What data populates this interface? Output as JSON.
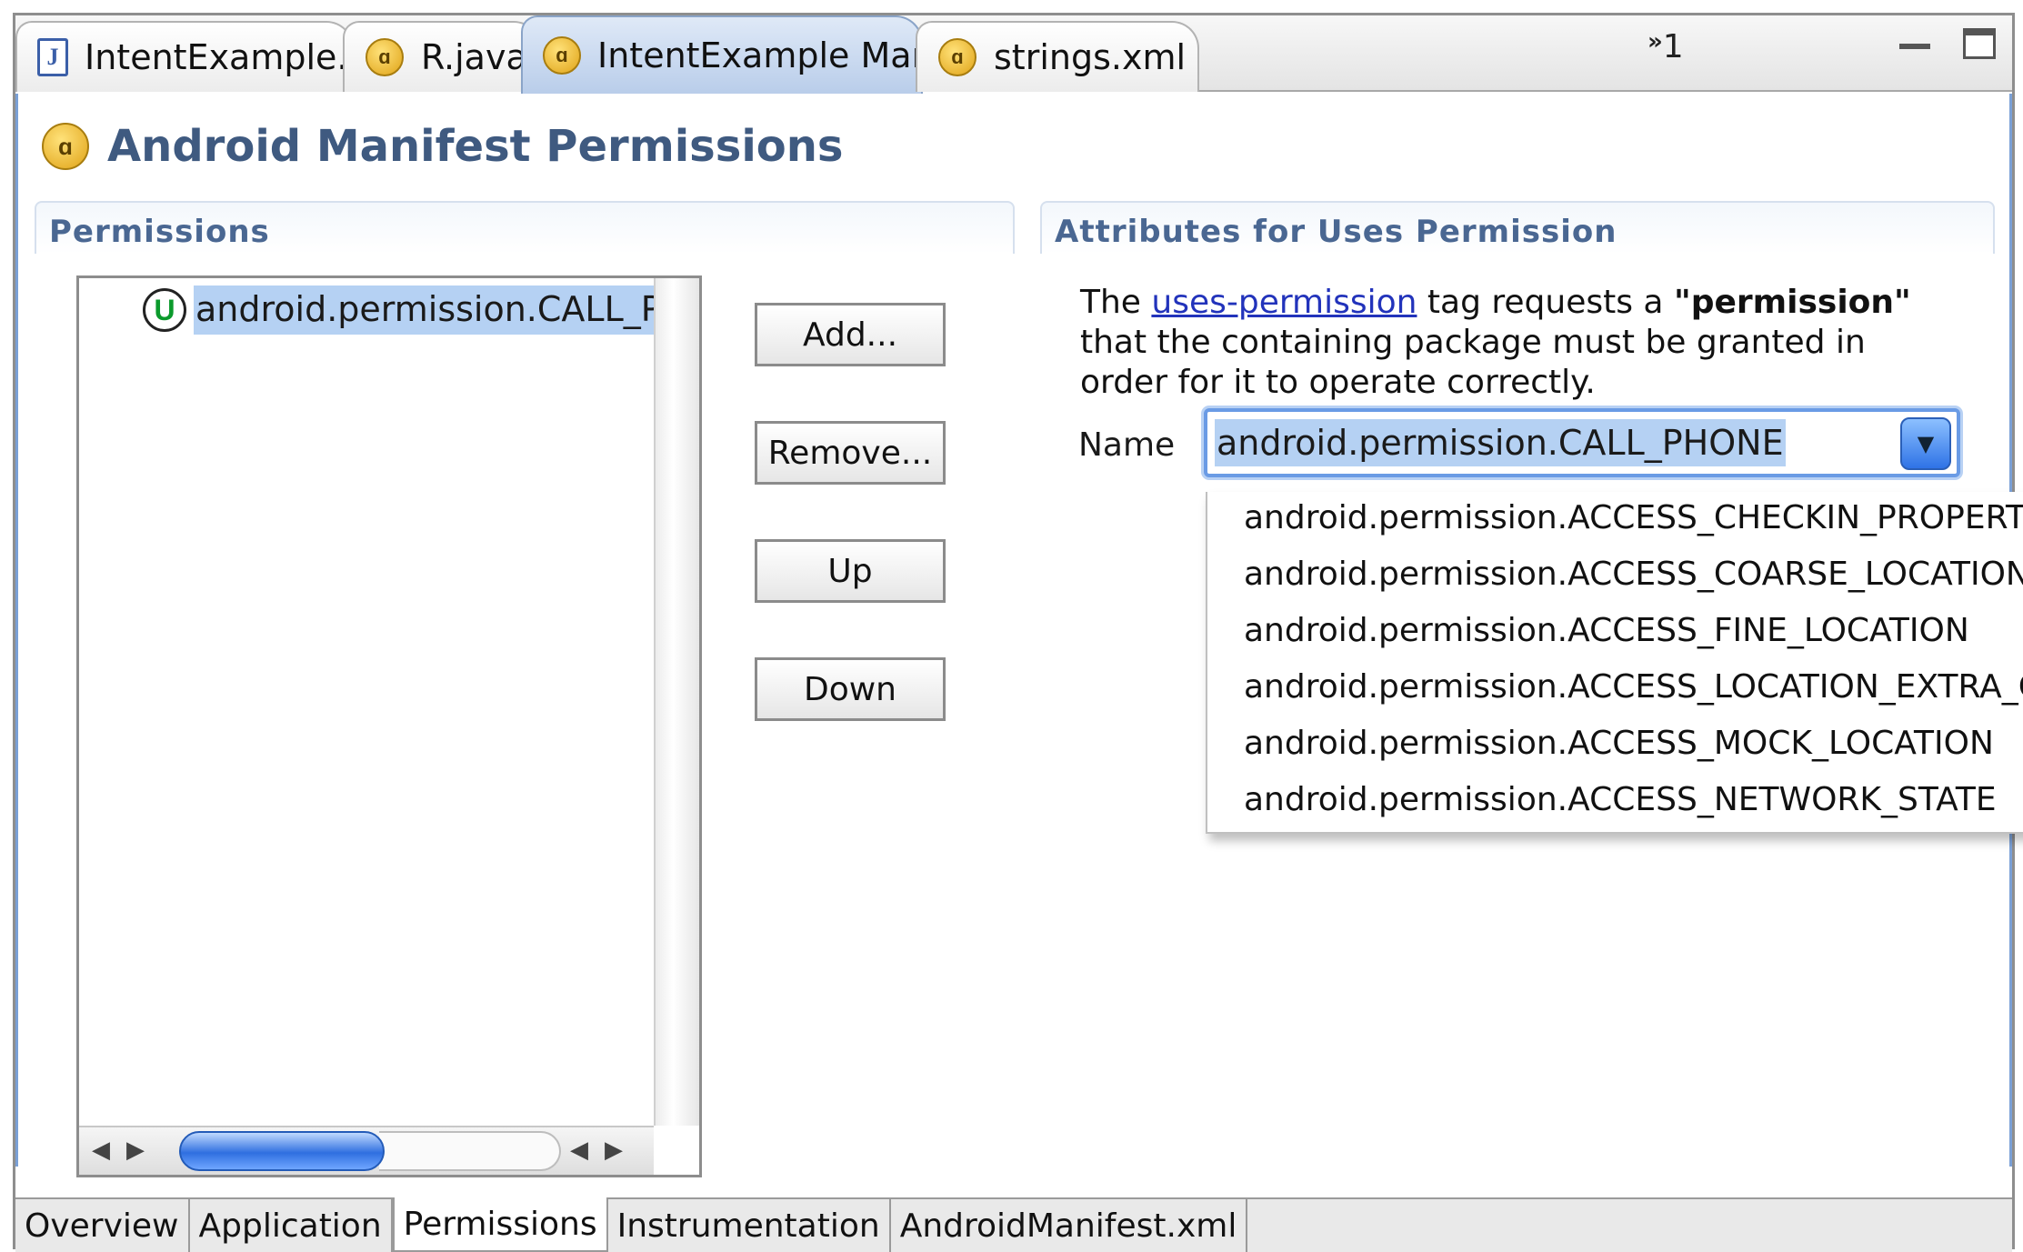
{
  "editor_tabs": [
    {
      "label": "IntentExample.java",
      "icon": "java-file-icon",
      "active": false
    },
    {
      "label": "R.java",
      "icon": "android-icon",
      "active": false
    },
    {
      "label": "IntentExample Manife",
      "icon": "android-icon",
      "active": true,
      "close_glyph": "☒"
    },
    {
      "label": "strings.xml",
      "icon": "android-icon",
      "active": false
    }
  ],
  "overflow_tabs": {
    "chevron": "»",
    "count": "1"
  },
  "page_title": "Android Manifest Permissions",
  "permissions_section": {
    "title": "Permissions",
    "items": [
      {
        "label": "android.permission.CALL_PHONE",
        "icon": "uses-permission-icon",
        "icon_glyph": "U"
      }
    ]
  },
  "buttons": {
    "add": "Add...",
    "remove": "Remove...",
    "up": "Up",
    "down": "Down"
  },
  "attributes_section": {
    "title": "Attributes for Uses Permission",
    "desc_prefix": "The ",
    "desc_link": "uses-permission",
    "desc_middle": " tag requests a ",
    "desc_bold": "\"permission\"",
    "desc_line2": "that the containing package must be granted in",
    "desc_line3": "order for it to operate correctly.",
    "name_label": "Name",
    "name_value": "android.permission.CALL_PHONE"
  },
  "dropdown_options": [
    "android.permission.ACCESS_CHECKIN_PROPERTIES",
    "android.permission.ACCESS_COARSE_LOCATION",
    "android.permission.ACCESS_FINE_LOCATION",
    "android.permission.ACCESS_LOCATION_EXTRA_COMMANDS",
    "android.permission.ACCESS_MOCK_LOCATION",
    "android.permission.ACCESS_NETWORK_STATE"
  ],
  "bottom_tabs": [
    {
      "label": "Overview",
      "active": false
    },
    {
      "label": "Application",
      "active": false
    },
    {
      "label": "Permissions",
      "active": true
    },
    {
      "label": "Instrumentation",
      "active": false
    },
    {
      "label": "AndroidManifest.xml",
      "active": false
    }
  ],
  "colors": {
    "accent": "#7aa0d6",
    "selection": "#b5d1f3",
    "section_title": "#4a6792"
  }
}
